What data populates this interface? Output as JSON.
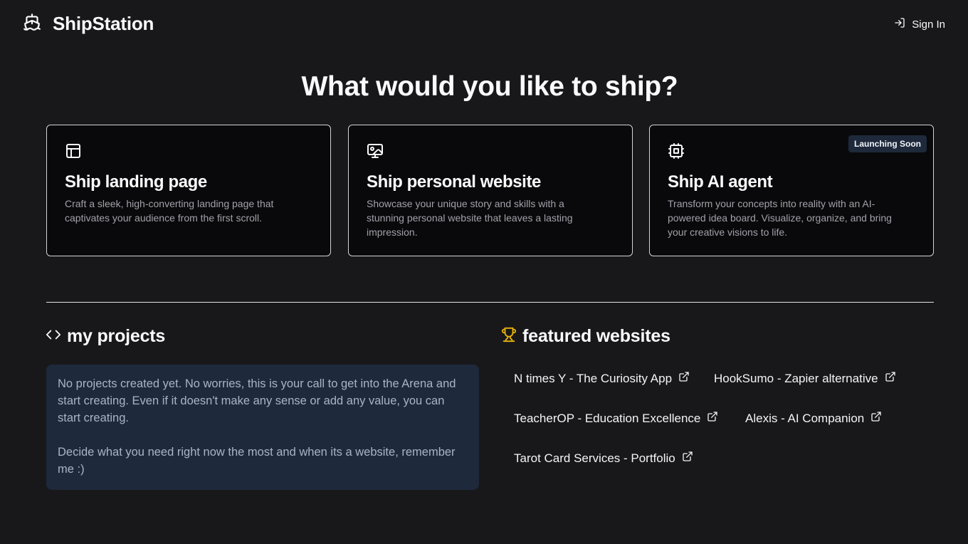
{
  "header": {
    "brand_name": "ShipStation",
    "brand_icon": "ship-icon",
    "signin_label": "Sign In",
    "signin_icon": "log-in-icon"
  },
  "main": {
    "title": "What would you like to ship?",
    "cards": [
      {
        "icon": "layout-template-icon",
        "title": "Ship landing page",
        "description": "Craft a sleek, high-converting landing page that captivates your audience from the first scroll."
      },
      {
        "icon": "monitor-image-icon",
        "title": "Ship personal website",
        "description": "Showcase your unique story and skills with a stunning personal website that leaves a lasting impression."
      },
      {
        "icon": "cpu-chip-icon",
        "title": "Ship AI agent",
        "description": "Transform your concepts into reality with an AI-powered idea board. Visualize, organize, and bring your creative visions to life.",
        "badge": "Launching Soon"
      }
    ]
  },
  "projects": {
    "heading": "my projects",
    "icon": "code-icon",
    "empty_message": [
      "No projects created yet. No worries, this is your call to get into the Arena and start creating. Even if it doesn't make any sense or add any value, you can start creating.",
      "Decide what you need right now the most and when its a website, remember me :)"
    ]
  },
  "featured": {
    "heading": "featured websites",
    "icon": "trophy-icon",
    "accent_color": "#eab308",
    "links": [
      {
        "label": "N times Y - The Curiosity App",
        "icon": "external-link-icon"
      },
      {
        "label": "HookSumo - Zapier alternative",
        "icon": "external-link-icon"
      },
      {
        "label": "TeacherOP - Education Excellence",
        "icon": "external-link-icon"
      },
      {
        "label": "Alexis - AI Companion",
        "icon": "external-link-icon"
      },
      {
        "label": "Tarot Card Services - Portfolio",
        "icon": "external-link-icon"
      }
    ]
  }
}
